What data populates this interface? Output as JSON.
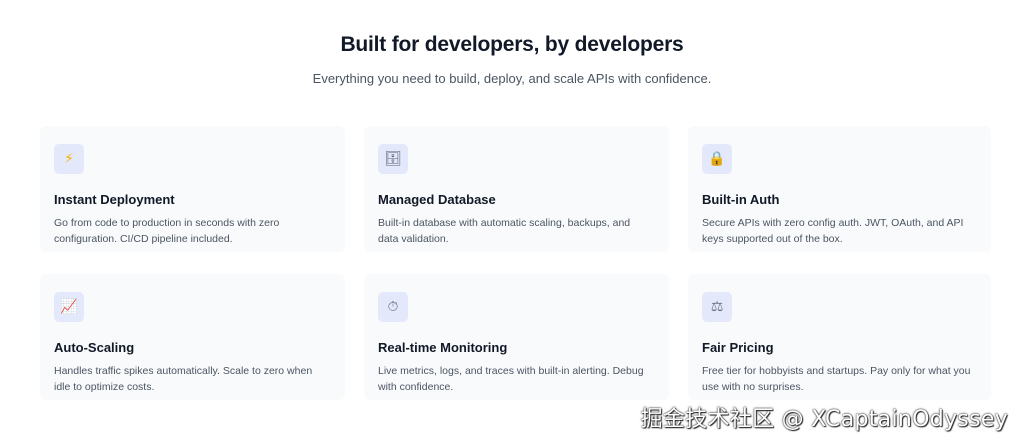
{
  "section": {
    "title": "Built for developers, by developers",
    "subtitle": "Everything you need to build, deploy, and scale APIs with confidence."
  },
  "features": [
    {
      "icon": "lightning-icon",
      "glyph": "⚡",
      "icon_color": "#f5b301",
      "title": "Instant Deployment",
      "description": "Go from code to production in seconds with zero configuration. CI/CD pipeline included."
    },
    {
      "icon": "file-cabinet-icon",
      "glyph": "🗄",
      "icon_color": "#5b6170",
      "title": "Managed Database",
      "description": "Built-in database with automatic scaling, backups, and data validation."
    },
    {
      "icon": "lock-icon",
      "glyph": "🔒",
      "icon_color": "#c9a227",
      "title": "Built-in Auth",
      "description": "Secure APIs with zero config auth. JWT, OAuth, and API keys supported out of the box."
    },
    {
      "icon": "chart-increasing-icon",
      "glyph": "📈",
      "icon_color": "#d64545",
      "title": "Auto-Scaling",
      "description": "Handles traffic spikes automatically. Scale to zero when idle to optimize costs."
    },
    {
      "icon": "stopwatch-icon",
      "glyph": "⏱",
      "icon_color": "#6b7280",
      "title": "Real-time Monitoring",
      "description": "Live metrics, logs, and traces with built-in alerting. Debug with confidence."
    },
    {
      "icon": "balance-scale-icon",
      "glyph": "⚖",
      "icon_color": "#6b7280",
      "title": "Fair Pricing",
      "description": "Free tier for hobbyists and startups. Pay only for what you use with no surprises."
    }
  ],
  "watermark": "掘金技术社区 @ XCaptainOdyssey"
}
